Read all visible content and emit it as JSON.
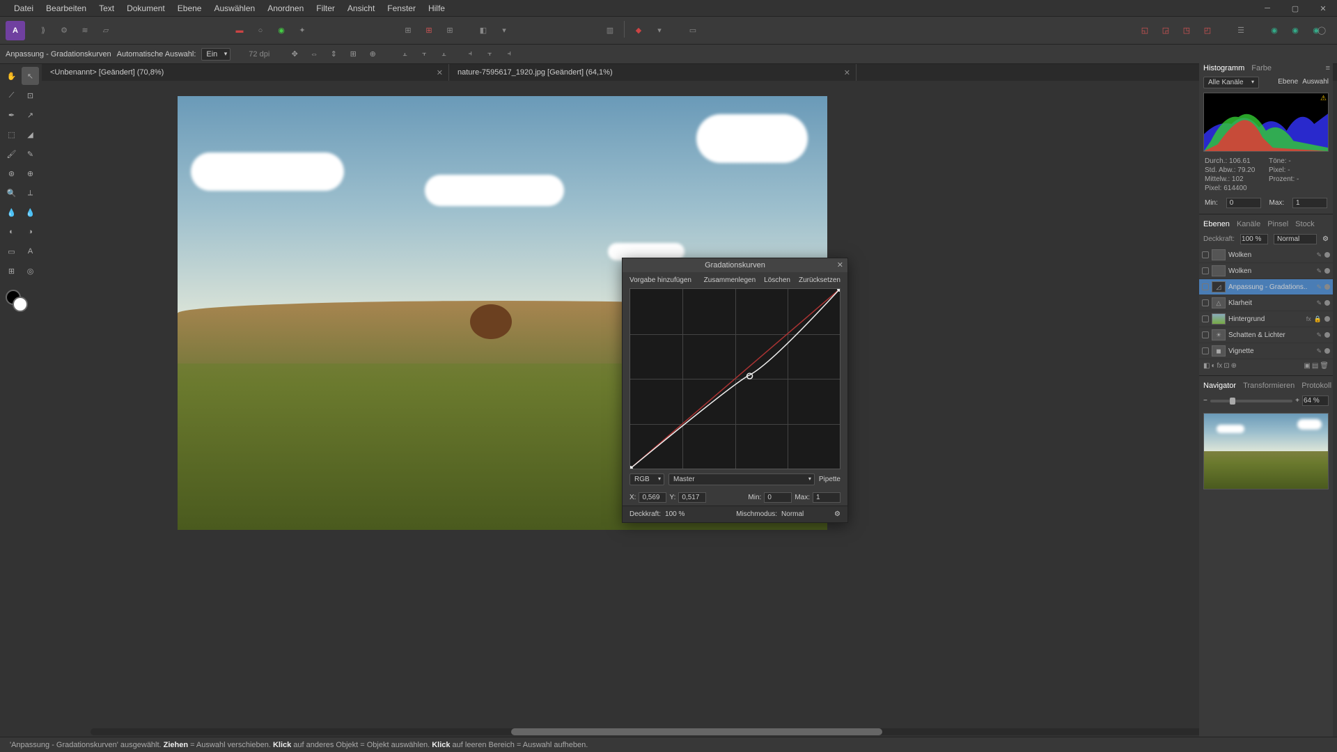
{
  "menu": [
    "Datei",
    "Bearbeiten",
    "Text",
    "Dokument",
    "Ebene",
    "Auswählen",
    "Anordnen",
    "Filter",
    "Ansicht",
    "Fenster",
    "Hilfe"
  ],
  "context": {
    "title": "Anpassung - Gradationskurven",
    "auto_label": "Automatische Auswahl:",
    "auto_val": "Ein",
    "dpi": "72 dpi"
  },
  "tabs": [
    {
      "label": "<Unbenannt> [Geändert] (70,8%)"
    },
    {
      "label": "nature-7595617_1920.jpg [Geändert] (64,1%)"
    }
  ],
  "hist_tabs": [
    "Histogramm",
    "Farbe"
  ],
  "hist_links": [
    "Ebene",
    "Auswahl"
  ],
  "hist_channel": "Alle Kanäle",
  "stats": {
    "durch": "Durch.: 106.61",
    "std": "Std. Abw.: 79.20",
    "mitt": "Mittelw.: 102",
    "pix": "Pixel: 614400",
    "tone": "Töne: -",
    "pixlbl": "Pixel: -",
    "proz": "Prozent: -"
  },
  "minmax": {
    "minl": "Min:",
    "min": "0",
    "maxl": "Max:",
    "max": "1"
  },
  "layer_tabs": [
    "Ebenen",
    "Kanäle",
    "Pinsel",
    "Stock"
  ],
  "opacity": {
    "lbl": "Deckkraft:",
    "val": "100 %",
    "blend": "Normal"
  },
  "layers": [
    {
      "n": "Wolken",
      "t": "cloud"
    },
    {
      "n": "Wolken",
      "t": "cloud"
    },
    {
      "n": "Anpassung - Gradations..",
      "t": "curves",
      "sel": true
    },
    {
      "n": "Klarheit",
      "t": "tri"
    },
    {
      "n": "Hintergrund",
      "t": "grad",
      "fx": true,
      "lock": true
    },
    {
      "n": "Schatten & Lichter",
      "t": "sun"
    },
    {
      "n": "Vignette",
      "t": "vig"
    }
  ],
  "nav_tabs": [
    "Navigator",
    "Transformieren",
    "Protokoll"
  ],
  "nav_zoom": "64 %",
  "curves": {
    "title": "Gradationskurven",
    "add": "Vorgabe hinzufügen",
    "merge": "Zusammenlegen",
    "del": "Löschen",
    "reset": "Zurücksetzen",
    "ch": "RGB",
    "master": "Master",
    "pip": "Pipette",
    "x": "0,569",
    "y": "0,517",
    "min": "0",
    "max": "1",
    "xl": "X:",
    "yl": "Y:",
    "minl": "Min:",
    "maxl": "Max:",
    "op_l": "Deckkraft:",
    "op": "100 %",
    "mix_l": "Mischmodus:",
    "mix": "Normal"
  },
  "status": {
    "p1": "'Anpassung - Gradationskurven' ausgewählt.",
    "b1": "Ziehen",
    "p2": "= Auswahl verschieben.",
    "b2": "Klick",
    "p3": "auf anderes Objekt = Objekt auswählen.",
    "b3": "Klick",
    "p4": "auf leeren Bereich = Auswahl aufheben."
  }
}
